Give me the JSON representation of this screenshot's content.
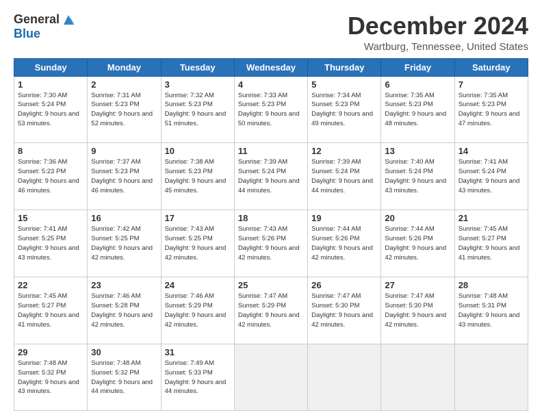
{
  "header": {
    "logo_general": "General",
    "logo_blue": "Blue",
    "month_title": "December 2024",
    "location": "Wartburg, Tennessee, United States"
  },
  "weekdays": [
    "Sunday",
    "Monday",
    "Tuesday",
    "Wednesday",
    "Thursday",
    "Friday",
    "Saturday"
  ],
  "weeks": [
    [
      {
        "day": "1",
        "sunrise": "Sunrise: 7:30 AM",
        "sunset": "Sunset: 5:24 PM",
        "daylight": "Daylight: 9 hours and 53 minutes."
      },
      {
        "day": "2",
        "sunrise": "Sunrise: 7:31 AM",
        "sunset": "Sunset: 5:23 PM",
        "daylight": "Daylight: 9 hours and 52 minutes."
      },
      {
        "day": "3",
        "sunrise": "Sunrise: 7:32 AM",
        "sunset": "Sunset: 5:23 PM",
        "daylight": "Daylight: 9 hours and 51 minutes."
      },
      {
        "day": "4",
        "sunrise": "Sunrise: 7:33 AM",
        "sunset": "Sunset: 5:23 PM",
        "daylight": "Daylight: 9 hours and 50 minutes."
      },
      {
        "day": "5",
        "sunrise": "Sunrise: 7:34 AM",
        "sunset": "Sunset: 5:23 PM",
        "daylight": "Daylight: 9 hours and 49 minutes."
      },
      {
        "day": "6",
        "sunrise": "Sunrise: 7:35 AM",
        "sunset": "Sunset: 5:23 PM",
        "daylight": "Daylight: 9 hours and 48 minutes."
      },
      {
        "day": "7",
        "sunrise": "Sunrise: 7:35 AM",
        "sunset": "Sunset: 5:23 PM",
        "daylight": "Daylight: 9 hours and 47 minutes."
      }
    ],
    [
      {
        "day": "8",
        "sunrise": "Sunrise: 7:36 AM",
        "sunset": "Sunset: 5:23 PM",
        "daylight": "Daylight: 9 hours and 46 minutes."
      },
      {
        "day": "9",
        "sunrise": "Sunrise: 7:37 AM",
        "sunset": "Sunset: 5:23 PM",
        "daylight": "Daylight: 9 hours and 46 minutes."
      },
      {
        "day": "10",
        "sunrise": "Sunrise: 7:38 AM",
        "sunset": "Sunset: 5:23 PM",
        "daylight": "Daylight: 9 hours and 45 minutes."
      },
      {
        "day": "11",
        "sunrise": "Sunrise: 7:39 AM",
        "sunset": "Sunset: 5:24 PM",
        "daylight": "Daylight: 9 hours and 44 minutes."
      },
      {
        "day": "12",
        "sunrise": "Sunrise: 7:39 AM",
        "sunset": "Sunset: 5:24 PM",
        "daylight": "Daylight: 9 hours and 44 minutes."
      },
      {
        "day": "13",
        "sunrise": "Sunrise: 7:40 AM",
        "sunset": "Sunset: 5:24 PM",
        "daylight": "Daylight: 9 hours and 43 minutes."
      },
      {
        "day": "14",
        "sunrise": "Sunrise: 7:41 AM",
        "sunset": "Sunset: 5:24 PM",
        "daylight": "Daylight: 9 hours and 43 minutes."
      }
    ],
    [
      {
        "day": "15",
        "sunrise": "Sunrise: 7:41 AM",
        "sunset": "Sunset: 5:25 PM",
        "daylight": "Daylight: 9 hours and 43 minutes."
      },
      {
        "day": "16",
        "sunrise": "Sunrise: 7:42 AM",
        "sunset": "Sunset: 5:25 PM",
        "daylight": "Daylight: 9 hours and 42 minutes."
      },
      {
        "day": "17",
        "sunrise": "Sunrise: 7:43 AM",
        "sunset": "Sunset: 5:25 PM",
        "daylight": "Daylight: 9 hours and 42 minutes."
      },
      {
        "day": "18",
        "sunrise": "Sunrise: 7:43 AM",
        "sunset": "Sunset: 5:26 PM",
        "daylight": "Daylight: 9 hours and 42 minutes."
      },
      {
        "day": "19",
        "sunrise": "Sunrise: 7:44 AM",
        "sunset": "Sunset: 5:26 PM",
        "daylight": "Daylight: 9 hours and 42 minutes."
      },
      {
        "day": "20",
        "sunrise": "Sunrise: 7:44 AM",
        "sunset": "Sunset: 5:26 PM",
        "daylight": "Daylight: 9 hours and 42 minutes."
      },
      {
        "day": "21",
        "sunrise": "Sunrise: 7:45 AM",
        "sunset": "Sunset: 5:27 PM",
        "daylight": "Daylight: 9 hours and 41 minutes."
      }
    ],
    [
      {
        "day": "22",
        "sunrise": "Sunrise: 7:45 AM",
        "sunset": "Sunset: 5:27 PM",
        "daylight": "Daylight: 9 hours and 41 minutes."
      },
      {
        "day": "23",
        "sunrise": "Sunrise: 7:46 AM",
        "sunset": "Sunset: 5:28 PM",
        "daylight": "Daylight: 9 hours and 42 minutes."
      },
      {
        "day": "24",
        "sunrise": "Sunrise: 7:46 AM",
        "sunset": "Sunset: 5:29 PM",
        "daylight": "Daylight: 9 hours and 42 minutes."
      },
      {
        "day": "25",
        "sunrise": "Sunrise: 7:47 AM",
        "sunset": "Sunset: 5:29 PM",
        "daylight": "Daylight: 9 hours and 42 minutes."
      },
      {
        "day": "26",
        "sunrise": "Sunrise: 7:47 AM",
        "sunset": "Sunset: 5:30 PM",
        "daylight": "Daylight: 9 hours and 42 minutes."
      },
      {
        "day": "27",
        "sunrise": "Sunrise: 7:47 AM",
        "sunset": "Sunset: 5:30 PM",
        "daylight": "Daylight: 9 hours and 42 minutes."
      },
      {
        "day": "28",
        "sunrise": "Sunrise: 7:48 AM",
        "sunset": "Sunset: 5:31 PM",
        "daylight": "Daylight: 9 hours and 43 minutes."
      }
    ],
    [
      {
        "day": "29",
        "sunrise": "Sunrise: 7:48 AM",
        "sunset": "Sunset: 5:32 PM",
        "daylight": "Daylight: 9 hours and 43 minutes."
      },
      {
        "day": "30",
        "sunrise": "Sunrise: 7:48 AM",
        "sunset": "Sunset: 5:32 PM",
        "daylight": "Daylight: 9 hours and 44 minutes."
      },
      {
        "day": "31",
        "sunrise": "Sunrise: 7:49 AM",
        "sunset": "Sunset: 5:33 PM",
        "daylight": "Daylight: 9 hours and 44 minutes."
      },
      null,
      null,
      null,
      null
    ]
  ]
}
